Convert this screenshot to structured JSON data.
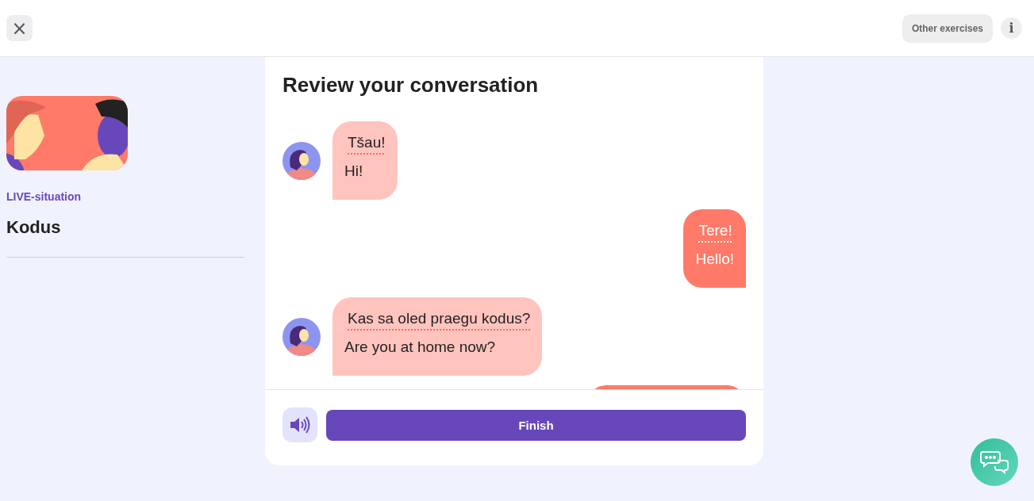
{
  "header": {
    "close": "×",
    "other_exercises": "Other exercises",
    "info": "i"
  },
  "lesson": {
    "kind": "picture",
    "category": "LIVE-situation",
    "title": "Kodus"
  },
  "review": {
    "title": "Review your conversation",
    "messages": [
      {
        "kind": "incoming",
        "phrase": "Tšau!",
        "translation": "Hi!"
      },
      {
        "kind": "outgoing",
        "phrase": "Tere!",
        "translation": "Hello!"
      },
      {
        "kind": "incoming",
        "phrase": "Kas sa oled praegu kodus?",
        "translation": "Are you at home now?"
      },
      {
        "kind": "outgoing"
      }
    ],
    "finish": "Finish"
  }
}
